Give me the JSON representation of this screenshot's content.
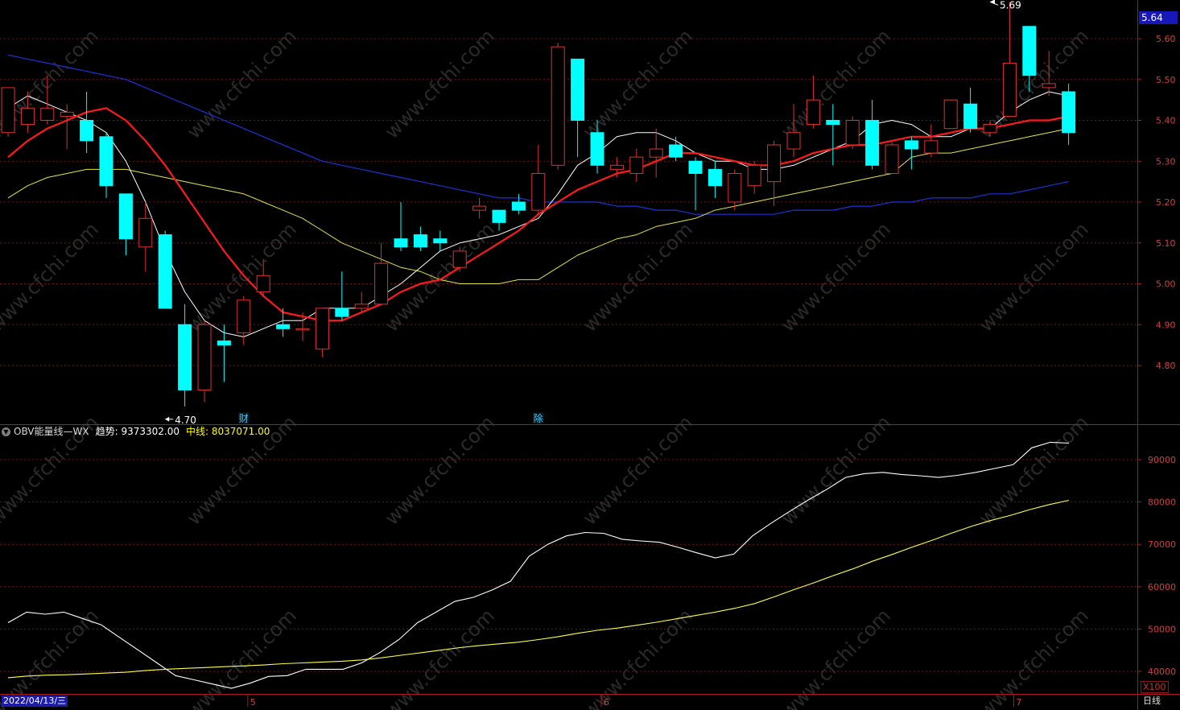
{
  "chart_data": [
    {
      "type": "candlestick",
      "price_axis": {
        "ticks": [
          5.6,
          5.5,
          5.4,
          5.3,
          5.2,
          5.1,
          5.0,
          4.9,
          4.8
        ],
        "range": [
          4.67,
          5.7
        ]
      },
      "last_price_label": "5.64",
      "high_marker": {
        "label": "5.69",
        "value": 5.69,
        "index": 50
      },
      "low_marker": {
        "label": "4.70",
        "value": 4.7,
        "index": 8
      },
      "event_markers": [
        {
          "label": "财",
          "index": 12
        },
        {
          "label": "除",
          "index": 27
        }
      ],
      "candles": [
        {
          "o": 5.37,
          "c": 5.48,
          "h": 5.48,
          "l": 5.36
        },
        {
          "o": 5.39,
          "c": 5.43,
          "h": 5.47,
          "l": 5.37
        },
        {
          "o": 5.4,
          "c": 5.43,
          "h": 5.51,
          "l": 5.39
        },
        {
          "o": 5.41,
          "c": 5.42,
          "h": 5.44,
          "l": 5.33
        },
        {
          "o": 5.4,
          "c": 5.35,
          "h": 5.47,
          "l": 5.32
        },
        {
          "o": 5.36,
          "c": 5.24,
          "h": 5.37,
          "l": 5.21
        },
        {
          "o": 5.22,
          "c": 5.11,
          "h": 5.22,
          "l": 5.07
        },
        {
          "o": 5.09,
          "c": 5.16,
          "h": 5.2,
          "l": 5.03
        },
        {
          "o": 5.12,
          "c": 4.94,
          "h": 5.13,
          "l": 4.94
        },
        {
          "o": 4.9,
          "c": 4.74,
          "h": 4.95,
          "l": 4.7
        },
        {
          "o": 4.74,
          "c": 4.9,
          "h": 4.91,
          "l": 4.71
        },
        {
          "o": 4.86,
          "c": 4.85,
          "h": 4.9,
          "l": 4.76
        },
        {
          "o": 4.88,
          "c": 4.96,
          "h": 4.97,
          "l": 4.85
        },
        {
          "o": 4.98,
          "c": 5.02,
          "h": 5.06,
          "l": 4.97
        },
        {
          "o": 4.9,
          "c": 4.89,
          "h": 4.94,
          "l": 4.87
        },
        {
          "o": 4.89,
          "c": 4.89,
          "h": 4.93,
          "l": 4.86
        },
        {
          "o": 4.84,
          "c": 4.94,
          "h": 4.94,
          "l": 4.82
        },
        {
          "o": 4.94,
          "c": 4.92,
          "h": 5.03,
          "l": 4.91
        },
        {
          "o": 4.94,
          "c": 4.95,
          "h": 4.98,
          "l": 4.93
        },
        {
          "o": 4.95,
          "c": 5.05,
          "h": 5.1,
          "l": 4.95
        },
        {
          "o": 5.11,
          "c": 5.09,
          "h": 5.2,
          "l": 5.08
        },
        {
          "o": 5.12,
          "c": 5.09,
          "h": 5.14,
          "l": 5.08
        },
        {
          "o": 5.11,
          "c": 5.1,
          "h": 5.13,
          "l": 5.08
        },
        {
          "o": 5.04,
          "c": 5.08,
          "h": 5.09,
          "l": 5.03
        },
        {
          "o": 5.18,
          "c": 5.19,
          "h": 5.21,
          "l": 5.16
        },
        {
          "o": 5.18,
          "c": 5.15,
          "h": 5.18,
          "l": 5.13
        },
        {
          "o": 5.2,
          "c": 5.18,
          "h": 5.22,
          "l": 5.17
        },
        {
          "o": 5.18,
          "c": 5.27,
          "h": 5.34,
          "l": 5.17
        },
        {
          "o": 5.29,
          "c": 5.58,
          "h": 5.59,
          "l": 5.28
        },
        {
          "o": 5.55,
          "c": 5.4,
          "h": 5.55,
          "l": 5.31
        },
        {
          "o": 5.37,
          "c": 5.29,
          "h": 5.4,
          "l": 5.27
        },
        {
          "o": 5.28,
          "c": 5.29,
          "h": 5.31,
          "l": 5.26
        },
        {
          "o": 5.27,
          "c": 5.31,
          "h": 5.33,
          "l": 5.25
        },
        {
          "o": 5.31,
          "c": 5.33,
          "h": 5.38,
          "l": 5.26
        },
        {
          "o": 5.34,
          "c": 5.31,
          "h": 5.36,
          "l": 5.3
        },
        {
          "o": 5.3,
          "c": 5.27,
          "h": 5.31,
          "l": 5.18
        },
        {
          "o": 5.28,
          "c": 5.24,
          "h": 5.3,
          "l": 5.21
        },
        {
          "o": 5.2,
          "c": 5.27,
          "h": 5.28,
          "l": 5.18
        },
        {
          "o": 5.24,
          "c": 5.29,
          "h": 5.3,
          "l": 5.22
        },
        {
          "o": 5.25,
          "c": 5.34,
          "h": 5.35,
          "l": 5.19
        },
        {
          "o": 5.33,
          "c": 5.37,
          "h": 5.44,
          "l": 5.31
        },
        {
          "o": 5.39,
          "c": 5.45,
          "h": 5.51,
          "l": 5.38
        },
        {
          "o": 5.4,
          "c": 5.39,
          "h": 5.44,
          "l": 5.29
        },
        {
          "o": 5.34,
          "c": 5.4,
          "h": 5.41,
          "l": 5.33
        },
        {
          "o": 5.4,
          "c": 5.29,
          "h": 5.45,
          "l": 5.28
        },
        {
          "o": 5.27,
          "c": 5.34,
          "h": 5.35,
          "l": 5.27
        },
        {
          "o": 5.35,
          "c": 5.33,
          "h": 5.36,
          "l": 5.28
        },
        {
          "o": 5.32,
          "c": 5.35,
          "h": 5.39,
          "l": 5.31
        },
        {
          "o": 5.38,
          "c": 5.45,
          "h": 5.45,
          "l": 5.38
        },
        {
          "o": 5.44,
          "c": 5.38,
          "h": 5.48,
          "l": 5.37
        },
        {
          "o": 5.37,
          "c": 5.39,
          "h": 5.4,
          "l": 5.36
        },
        {
          "o": 5.41,
          "c": 5.54,
          "h": 5.69,
          "l": 5.41
        },
        {
          "o": 5.63,
          "c": 5.51,
          "h": 5.63,
          "l": 5.47
        },
        {
          "o": 5.48,
          "c": 5.49,
          "h": 5.57,
          "l": 5.46
        },
        {
          "o": 5.47,
          "c": 5.37,
          "h": 5.49,
          "l": 5.34
        }
      ],
      "ma_short": [
        5.43,
        5.46,
        5.44,
        5.42,
        5.4,
        5.37,
        5.3,
        5.2,
        5.08,
        4.98,
        4.91,
        4.88,
        4.87,
        4.89,
        4.91,
        4.91,
        4.94,
        4.94,
        4.94,
        4.97,
        5.0,
        5.04,
        5.08,
        5.1,
        5.11,
        5.12,
        5.14,
        5.16,
        5.22,
        5.29,
        5.32,
        5.36,
        5.37,
        5.37,
        5.35,
        5.32,
        5.3,
        5.3,
        5.28,
        5.28,
        5.29,
        5.31,
        5.33,
        5.35,
        5.39,
        5.4,
        5.39,
        5.36,
        5.36,
        5.38,
        5.38,
        5.42,
        5.45,
        5.47,
        5.46
      ],
      "ma_mid": [
        5.31,
        5.35,
        5.38,
        5.4,
        5.42,
        5.43,
        5.4,
        5.35,
        5.29,
        5.22,
        5.15,
        5.08,
        5.02,
        4.97,
        4.93,
        4.92,
        4.91,
        4.91,
        4.93,
        4.95,
        4.98,
        5.0,
        5.01,
        5.04,
        5.07,
        5.1,
        5.13,
        5.17,
        5.2,
        5.23,
        5.25,
        5.27,
        5.28,
        5.3,
        5.32,
        5.32,
        5.31,
        5.3,
        5.29,
        5.29,
        5.3,
        5.32,
        5.33,
        5.34,
        5.34,
        5.35,
        5.36,
        5.36,
        5.37,
        5.38,
        5.38,
        5.39,
        5.4,
        5.4,
        5.41
      ],
      "ma_long": [
        5.21,
        5.24,
        5.26,
        5.27,
        5.28,
        5.28,
        5.28,
        5.27,
        5.26,
        5.25,
        5.24,
        5.23,
        5.22,
        5.2,
        5.18,
        5.16,
        5.13,
        5.1,
        5.08,
        5.06,
        5.04,
        5.03,
        5.01,
        5.0,
        5.0,
        5.0,
        5.01,
        5.01,
        5.04,
        5.07,
        5.09,
        5.11,
        5.12,
        5.14,
        5.15,
        5.16,
        5.18,
        5.19,
        5.2,
        5.21,
        5.22,
        5.23,
        5.24,
        5.25,
        5.26,
        5.27,
        5.31,
        5.32,
        5.32,
        5.33,
        5.34,
        5.35,
        5.36,
        5.37,
        5.38
      ],
      "ma_xlong": [
        5.56,
        5.55,
        5.54,
        5.53,
        5.52,
        5.51,
        5.5,
        5.48,
        5.46,
        5.44,
        5.42,
        5.4,
        5.38,
        5.36,
        5.34,
        5.32,
        5.3,
        5.29,
        5.28,
        5.27,
        5.26,
        5.25,
        5.24,
        5.23,
        5.22,
        5.21,
        5.21,
        5.2,
        5.2,
        5.2,
        5.2,
        5.19,
        5.19,
        5.18,
        5.18,
        5.17,
        5.17,
        5.17,
        5.17,
        5.17,
        5.18,
        5.18,
        5.18,
        5.19,
        5.19,
        5.2,
        5.2,
        5.21,
        5.21,
        5.21,
        5.22,
        5.22,
        5.23,
        5.24,
        5.25
      ]
    },
    {
      "type": "line",
      "indicator": "OBV",
      "y_axis": {
        "ticks": [
          90000,
          80000,
          70000,
          60000,
          50000,
          40000
        ],
        "range": [
          37500,
          97000
        ],
        "unit_label": "X100"
      },
      "series": [
        {
          "name": "趋势",
          "color": "#ffffff",
          "values": [
            51500,
            54000,
            53500,
            54000,
            52500,
            51000,
            48000,
            45000,
            42000,
            39000,
            38000,
            37000,
            36000,
            37200,
            38800,
            39000,
            40500,
            40500,
            40500,
            42000,
            44500,
            47500,
            51500,
            54000,
            56500,
            57500,
            59200,
            61300,
            67200,
            70000,
            72000,
            72800,
            72600,
            71200,
            70800,
            70500,
            69300,
            68000,
            66800,
            67700,
            72000,
            75000,
            77800,
            80500,
            83000,
            85800,
            86700,
            87000,
            86500,
            86200,
            85800,
            86300,
            87000,
            87900,
            88800,
            92800,
            94100,
            93900
          ]
        },
        {
          "name": "中线",
          "color": "#ffff44",
          "values": [
            38500,
            38900,
            39100,
            39200,
            39400,
            39600,
            39800,
            40200,
            40500,
            40700,
            40900,
            41100,
            41300,
            41500,
            41800,
            42000,
            42200,
            42400,
            42700,
            43200,
            43800,
            44400,
            45000,
            45600,
            46100,
            46500,
            46900,
            47500,
            48200,
            49000,
            49700,
            50200,
            50900,
            51600,
            52400,
            53200,
            54000,
            54900,
            56000,
            57600,
            59300,
            60900,
            62600,
            64200,
            66000,
            67600,
            69300,
            70900,
            72600,
            74200,
            75600,
            76800,
            78200,
            79400,
            80400
          ]
        }
      ]
    }
  ],
  "indicator_header": {
    "collapse_icon": "chevron-down-icon",
    "name": "OBV能量线—WX",
    "trend_label": "趋势: 9373302.00",
    "mid_label": "中线: 8037071.00"
  },
  "time_axis": {
    "date_label": "2022/04/13/三",
    "month_labels": [
      {
        "label": "5",
        "index": 12
      },
      {
        "label": "6",
        "index": 30
      },
      {
        "label": "7",
        "index": 51
      }
    ],
    "period_label": "日线",
    "unit_label": "X100"
  },
  "watermark": "www.cfchi.com",
  "colors": {
    "background": "#000000",
    "up_candle": "#e03030",
    "down_candle": "#00ffff",
    "ma_short": "#ffffff",
    "ma_mid": "#ff1a1a",
    "ma_long": "#e6e63c",
    "ma_xlong": "#2030d8",
    "grid": "#7a1010",
    "axis_text_price": "#d04040",
    "price_tag_bg": "#1818b8"
  }
}
